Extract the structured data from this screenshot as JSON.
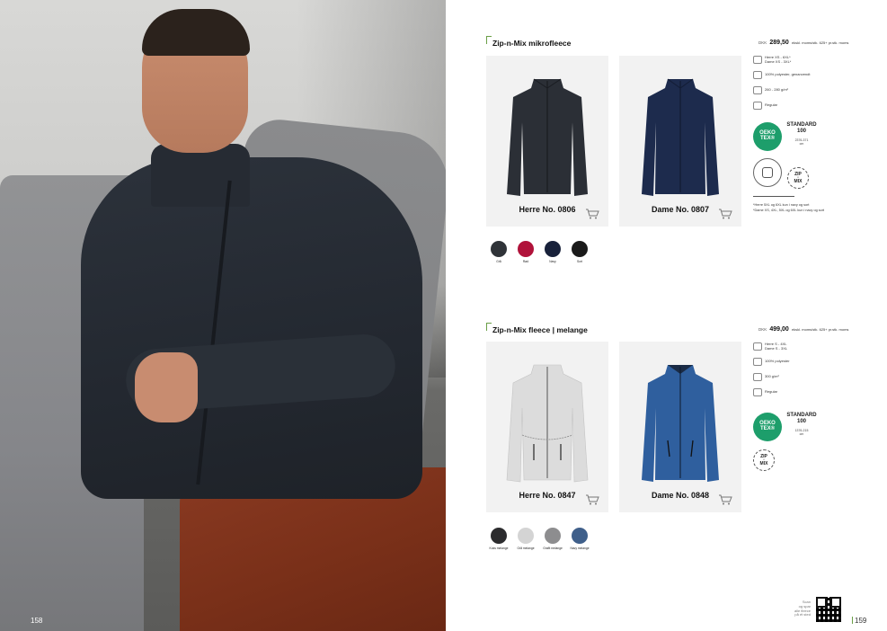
{
  "left_page": {
    "page_number": "158"
  },
  "right_page": {
    "page_number": "159",
    "sections": [
      {
        "title": "Zip-n-Mix mikrofleece",
        "price": {
          "currency": "DKK",
          "value": "289,50",
          "note": "ekskl. moms/stk. 625+ pr.stk. moms"
        },
        "products": [
          {
            "label": "Herre No. 0806",
            "color": "#2b2f36"
          },
          {
            "label": "Dame No. 0807",
            "color": "#1d2b4d"
          }
        ],
        "info": [
          {
            "icon": "size-icon",
            "text": "Herre XS - 6XL*\nDame XS - 3XL*"
          },
          {
            "icon": "material-icon",
            "text": "100% polyester, genanvendt"
          },
          {
            "icon": "weight-icon",
            "text": "260 - 280 g/m²"
          },
          {
            "icon": "fit-icon",
            "text": "Regular"
          }
        ],
        "oeko": {
          "badge": "OEKO\nTEX®",
          "standard": "STANDARD\n100",
          "code": "2376-371\ncm"
        },
        "badges": [
          "ZIP",
          "MIX"
        ],
        "notes": [
          "*Herre 5XL og 6XL kun i navy og sort",
          "*Dame XS, 4XL, 5XL og 6XL kun i navy og sort"
        ],
        "swatches": [
          {
            "name": "Grå",
            "color": "#2f3338"
          },
          {
            "name": "Rød",
            "color": "#b0123a"
          },
          {
            "name": "Navy",
            "color": "#18213a"
          },
          {
            "name": "Sort",
            "color": "#1a1a1a"
          }
        ]
      },
      {
        "title": "Zip-n-Mix fleece | melange",
        "price": {
          "currency": "DKK",
          "value": "499,00",
          "note": "ekskl. moms/stk. 625+ pr.stk. moms"
        },
        "products": [
          {
            "label": "Herre No. 0847",
            "color": "#d9d9d9"
          },
          {
            "label": "Dame No. 0848",
            "color": "#2f5f9e"
          }
        ],
        "info": [
          {
            "icon": "size-icon",
            "text": "Herre S - 4XL\nDame S - 3XL"
          },
          {
            "icon": "material-icon",
            "text": "100% polyester"
          },
          {
            "icon": "weight-icon",
            "text": "300 g/m²"
          },
          {
            "icon": "fit-icon",
            "text": "Regular"
          }
        ],
        "oeko": {
          "badge": "OEKO\nTEX®",
          "standard": "STANDARD\n100",
          "code": "1376-215\ncm"
        },
        "badges": [
          "ZIP",
          "MIX"
        ],
        "swatches": [
          {
            "name": "Koks melange",
            "color": "#2c2c2e"
          },
          {
            "name": "Grå melange",
            "color": "#d4d4d4"
          },
          {
            "name": "Grafit melange",
            "color": "#8d8d8f"
          },
          {
            "name": "Navy melange",
            "color": "#3f5f8a"
          }
        ]
      }
    ],
    "qr_text": "Scan\nog spar\nalle fleece\npå ét sted"
  }
}
